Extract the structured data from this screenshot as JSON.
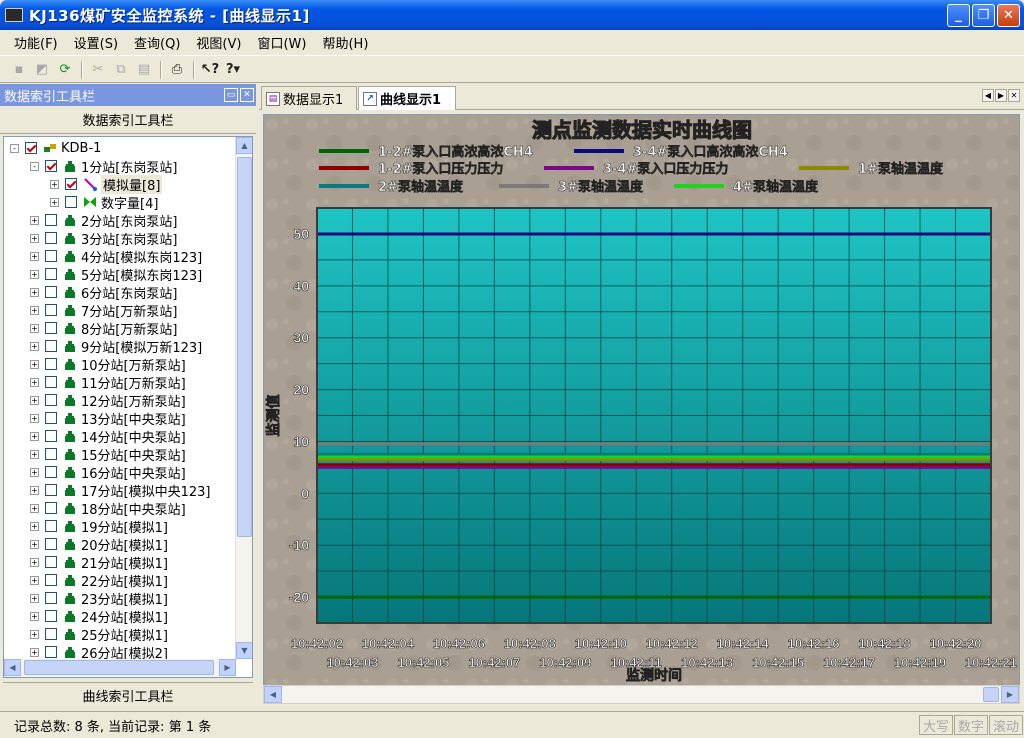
{
  "window": {
    "title": "KJ136煤矿安全监控系统 - [曲线显示1]"
  },
  "menu": [
    "功能(F)",
    "设置(S)",
    "查询(Q)",
    "视图(V)",
    "窗口(W)",
    "帮助(H)"
  ],
  "left_panel": {
    "header": "数据索引工具栏",
    "title": "数据索引工具栏",
    "bottom_label": "曲线索引工具栏",
    "tree": [
      {
        "label": "KDB-1",
        "level": 0,
        "expand": "-",
        "checked": true,
        "icon": "network-icon"
      },
      {
        "label": "1分站[东岗泵站]",
        "level": 1,
        "expand": "-",
        "checked": true,
        "icon": "station-icon"
      },
      {
        "label": "模拟量[8]",
        "level": 2,
        "expand": "+",
        "checked": true,
        "icon": "analog-icon",
        "highlight": true
      },
      {
        "label": "数字量[4]",
        "level": 2,
        "expand": "+",
        "checked": false,
        "icon": "digital-icon"
      },
      {
        "label": "2分站[东岗泵站]",
        "level": 1,
        "expand": "+",
        "checked": false,
        "icon": "station-icon"
      },
      {
        "label": "3分站[东岗泵站]",
        "level": 1,
        "expand": "+",
        "checked": false,
        "icon": "station-icon"
      },
      {
        "label": "4分站[模拟东岗123]",
        "level": 1,
        "expand": "+",
        "checked": false,
        "icon": "station-icon"
      },
      {
        "label": "5分站[模拟东岗123]",
        "level": 1,
        "expand": "+",
        "checked": false,
        "icon": "station-icon"
      },
      {
        "label": "6分站[东岗泵站]",
        "level": 1,
        "expand": "+",
        "checked": false,
        "icon": "station-icon"
      },
      {
        "label": "7分站[万新泵站]",
        "level": 1,
        "expand": "+",
        "checked": false,
        "icon": "station-icon"
      },
      {
        "label": "8分站[万新泵站]",
        "level": 1,
        "expand": "+",
        "checked": false,
        "icon": "station-icon"
      },
      {
        "label": "9分站[模拟万新123]",
        "level": 1,
        "expand": "+",
        "checked": false,
        "icon": "station-icon"
      },
      {
        "label": "10分站[万新泵站]",
        "level": 1,
        "expand": "+",
        "checked": false,
        "icon": "station-icon"
      },
      {
        "label": "11分站[万新泵站]",
        "level": 1,
        "expand": "+",
        "checked": false,
        "icon": "station-icon"
      },
      {
        "label": "12分站[万新泵站]",
        "level": 1,
        "expand": "+",
        "checked": false,
        "icon": "station-icon"
      },
      {
        "label": "13分站[中央泵站]",
        "level": 1,
        "expand": "+",
        "checked": false,
        "icon": "station-icon"
      },
      {
        "label": "14分站[中央泵站]",
        "level": 1,
        "expand": "+",
        "checked": false,
        "icon": "station-icon"
      },
      {
        "label": "15分站[中央泵站]",
        "level": 1,
        "expand": "+",
        "checked": false,
        "icon": "station-icon"
      },
      {
        "label": "16分站[中央泵站]",
        "level": 1,
        "expand": "+",
        "checked": false,
        "icon": "station-icon"
      },
      {
        "label": "17分站[模拟中央123]",
        "level": 1,
        "expand": "+",
        "checked": false,
        "icon": "station-icon"
      },
      {
        "label": "18分站[中央泵站]",
        "level": 1,
        "expand": "+",
        "checked": false,
        "icon": "station-icon"
      },
      {
        "label": "19分站[模拟1]",
        "level": 1,
        "expand": "+",
        "checked": false,
        "icon": "station-icon"
      },
      {
        "label": "20分站[模拟1]",
        "level": 1,
        "expand": "+",
        "checked": false,
        "icon": "station-icon"
      },
      {
        "label": "21分站[模拟1]",
        "level": 1,
        "expand": "+",
        "checked": false,
        "icon": "station-icon"
      },
      {
        "label": "22分站[模拟1]",
        "level": 1,
        "expand": "+",
        "checked": false,
        "icon": "station-icon"
      },
      {
        "label": "23分站[模拟1]",
        "level": 1,
        "expand": "+",
        "checked": false,
        "icon": "station-icon"
      },
      {
        "label": "24分站[模拟1]",
        "level": 1,
        "expand": "+",
        "checked": false,
        "icon": "station-icon"
      },
      {
        "label": "25分站[模拟1]",
        "level": 1,
        "expand": "+",
        "checked": false,
        "icon": "station-icon"
      },
      {
        "label": "26分站[模拟2]",
        "level": 1,
        "expand": "+",
        "checked": false,
        "icon": "station-icon"
      }
    ]
  },
  "tabs": [
    {
      "label": "数据显示1",
      "active": false
    },
    {
      "label": "曲线显示1",
      "active": true
    }
  ],
  "status": {
    "message": "记录总数: 8 条, 当前记录: 第 1 条",
    "indicators": [
      "大写",
      "数字",
      "滚动"
    ]
  },
  "colors": {
    "plot_top": "#1fc4c4",
    "plot_bottom": "#06777a",
    "titlebar": "#0a4fd6"
  },
  "chart_data": {
    "type": "line",
    "title": "测点监测数据实时曲线图",
    "xlabel": "监测时间",
    "ylabel": "监测值",
    "ylim": [
      -25,
      55
    ],
    "yticks": [
      50,
      40,
      30,
      20,
      10,
      0,
      -10,
      -20
    ],
    "x": [
      "10:42:02",
      "10:42:03",
      "10:42:04",
      "10:42:05",
      "10:42:06",
      "10:42:07",
      "10:42:08",
      "10:42:09",
      "10:42:10",
      "10:42:11",
      "10:42:12",
      "10:42:13",
      "10:42:14",
      "10:42:15",
      "10:42:16",
      "10:42:17",
      "10:42:18",
      "10:42:19",
      "10:42:20",
      "10:42:21"
    ],
    "legend_rows": [
      [
        0,
        1
      ],
      [
        2,
        3,
        4
      ],
      [
        5,
        6,
        7
      ]
    ],
    "series": [
      {
        "name": "1-2#泵入口高浓高浓CH4",
        "color": "#006400",
        "value": -20
      },
      {
        "name": "3-4#泵入口高浓高浓CH4",
        "color": "#0a0a80",
        "value": 50
      },
      {
        "name": "1-2#泵入口压力压力",
        "color": "#8b0000",
        "value": 5.5
      },
      {
        "name": "3-4#泵入口压力压力",
        "color": "#7a0a8a",
        "value": 5
      },
      {
        "name": "1#泵轴温温度",
        "color": "#8a8a00",
        "value": 6.5
      },
      {
        "name": "2#泵轴温温度",
        "color": "#0a7a80",
        "value": 7.5
      },
      {
        "name": "3#泵轴温温度",
        "color": "#7a7a7a",
        "value": 9.5
      },
      {
        "name": "4#泵轴温温度",
        "color": "#22d022",
        "value": 7
      }
    ]
  }
}
